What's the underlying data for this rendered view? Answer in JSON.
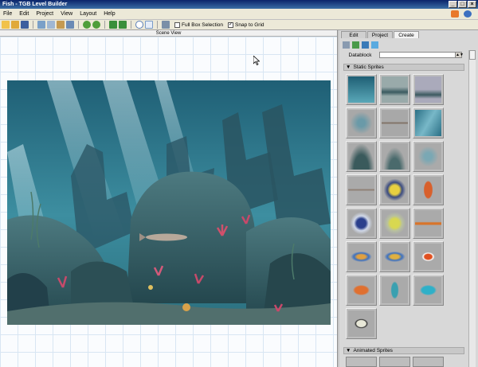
{
  "window": {
    "title": "Fish - TGB Level Builder"
  },
  "menu": [
    "File",
    "Edit",
    "Project",
    "View",
    "Layout",
    "Help"
  ],
  "toolbar": {
    "full_box_selection": {
      "label": "Full Box Selection",
      "checked": false
    },
    "snap_to_grid": {
      "label": "Snap to Grid",
      "checked": true
    }
  },
  "scene": {
    "title": "Scene View"
  },
  "panel": {
    "tabs": [
      {
        "label": "Edit",
        "active": false
      },
      {
        "label": "Project",
        "active": false
      },
      {
        "label": "Create",
        "active": true
      }
    ],
    "datablock_label": "Datablock",
    "datablock_value": "",
    "static_sprites_label": "Static Sprites",
    "animated_sprites_label": "Animated Sprites",
    "sprites": [
      "water-background",
      "rocks-strip",
      "rocks-ruins",
      "seaweed-plant",
      "small-fish-strip",
      "light-rays",
      "rock-cluster",
      "rock-small",
      "seaweed-small",
      "gray-fish",
      "yellow-angelfish",
      "seahorse-orange",
      "blue-angelfish",
      "yellow-fish",
      "orange-eel",
      "blue-fish-small",
      "blue-fish-2",
      "clownfish",
      "orange-fish",
      "teal-seahorse",
      "teal-fish",
      "white-triggerfish"
    ]
  },
  "colors": {
    "titlebar": "#0a246a",
    "water": "#2f7c8e",
    "grid_line": "#d8e6f3"
  }
}
